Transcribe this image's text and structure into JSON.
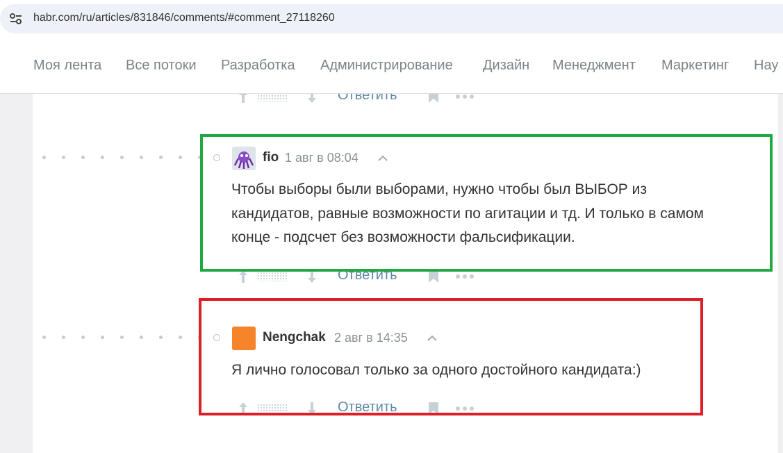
{
  "browser": {
    "url": "habr.com/ru/articles/831846/comments/#comment_27118260"
  },
  "nav": {
    "items": [
      "Моя лента",
      "Все потоки",
      "Разработка",
      "Администрирование",
      "Дизайн",
      "Менеджмент",
      "Маркетинг",
      "Нау"
    ]
  },
  "actions": {
    "reply_label": "Ответить"
  },
  "comments": [
    {
      "author": "fio",
      "time": "1 авг в 08:04",
      "lines": [
        "Чтобы выборы были выборами, нужно чтобы был ВЫБОР из",
        "кандидатов, равные возможности по агитации и тд. И только в самом",
        "конце - подсчет без возможности фальсификации."
      ]
    },
    {
      "author": "Nengchak",
      "time": "2 авг в 14:35",
      "lines": [
        "Я лично голосовал только за одного достойного кандидата:)"
      ]
    }
  ],
  "colors": {
    "highlight_green": "#22a843",
    "highlight_red": "#dd2027",
    "reply_link": "#5e8aa6",
    "avatar_nengchak": "#f6842a"
  },
  "icons": {
    "site_settings": "tune-icon",
    "vote_up": "arrow-up-icon",
    "vote_down": "arrow-down-icon",
    "bookmark": "bookmark-icon",
    "more": "ellipsis-icon",
    "collapse": "chevron-up-icon"
  }
}
